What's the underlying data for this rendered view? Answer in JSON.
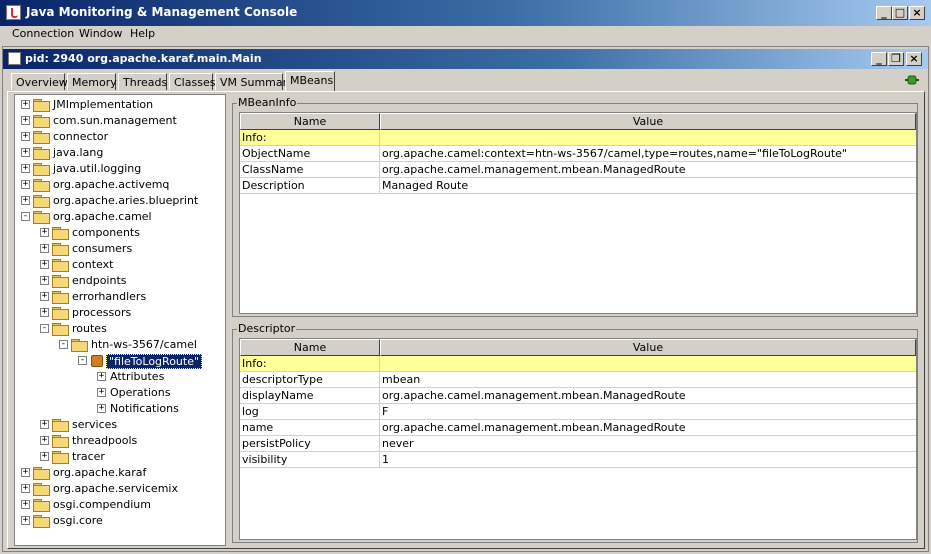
{
  "window": {
    "title": "Java Monitoring & Management Console"
  },
  "menu": [
    "Connection",
    "Window",
    "Help"
  ],
  "inner": {
    "title": "pid: 2940 org.apache.karaf.main.Main"
  },
  "tabs": [
    "Overview",
    "Memory",
    "Threads",
    "Classes",
    "VM Summary",
    "MBeans"
  ],
  "active_tab": "MBeans",
  "tree": [
    {
      "label": "JMImplementation",
      "depth": 0,
      "kind": "folder",
      "exp": "+"
    },
    {
      "label": "com.sun.management",
      "depth": 0,
      "kind": "folder",
      "exp": "+"
    },
    {
      "label": "connector",
      "depth": 0,
      "kind": "folder",
      "exp": "+"
    },
    {
      "label": "java.lang",
      "depth": 0,
      "kind": "folder",
      "exp": "+"
    },
    {
      "label": "java.util.logging",
      "depth": 0,
      "kind": "folder",
      "exp": "+"
    },
    {
      "label": "org.apache.activemq",
      "depth": 0,
      "kind": "folder",
      "exp": "+"
    },
    {
      "label": "org.apache.aries.blueprint",
      "depth": 0,
      "kind": "folder",
      "exp": "+"
    },
    {
      "label": "org.apache.camel",
      "depth": 0,
      "kind": "folder",
      "exp": "-"
    },
    {
      "label": "components",
      "depth": 1,
      "kind": "folder",
      "exp": "+"
    },
    {
      "label": "consumers",
      "depth": 1,
      "kind": "folder",
      "exp": "+"
    },
    {
      "label": "context",
      "depth": 1,
      "kind": "folder",
      "exp": "+"
    },
    {
      "label": "endpoints",
      "depth": 1,
      "kind": "folder",
      "exp": "+"
    },
    {
      "label": "errorhandlers",
      "depth": 1,
      "kind": "folder",
      "exp": "+"
    },
    {
      "label": "processors",
      "depth": 1,
      "kind": "folder",
      "exp": "+"
    },
    {
      "label": "routes",
      "depth": 1,
      "kind": "folder",
      "exp": "-"
    },
    {
      "label": "htn-ws-3567/camel",
      "depth": 2,
      "kind": "folder",
      "exp": "-"
    },
    {
      "label": "\"fileToLogRoute\"",
      "depth": 3,
      "kind": "bean",
      "exp": "-",
      "selected": true
    },
    {
      "label": "Attributes",
      "depth": 4,
      "kind": "leaf",
      "exp": "+"
    },
    {
      "label": "Operations",
      "depth": 4,
      "kind": "leaf",
      "exp": "+"
    },
    {
      "label": "Notifications",
      "depth": 4,
      "kind": "leaf",
      "exp": "+"
    },
    {
      "label": "services",
      "depth": 1,
      "kind": "folder",
      "exp": "+"
    },
    {
      "label": "threadpools",
      "depth": 1,
      "kind": "folder",
      "exp": "+"
    },
    {
      "label": "tracer",
      "depth": 1,
      "kind": "folder",
      "exp": "+"
    },
    {
      "label": "org.apache.karaf",
      "depth": 0,
      "kind": "folder",
      "exp": "+"
    },
    {
      "label": "org.apache.servicemix",
      "depth": 0,
      "kind": "folder",
      "exp": "+"
    },
    {
      "label": "osgi.compendium",
      "depth": 0,
      "kind": "folder",
      "exp": "+"
    },
    {
      "label": "osgi.core",
      "depth": 0,
      "kind": "folder",
      "exp": "+"
    }
  ],
  "mbeaninfo": {
    "title": "MBeanInfo",
    "col_name": "Name",
    "col_value": "Value",
    "rows": [
      {
        "name": "Info:",
        "value": "",
        "info": true
      },
      {
        "name": "ObjectName",
        "value": "org.apache.camel:context=htn-ws-3567/camel,type=routes,name=\"fileToLogRoute\""
      },
      {
        "name": "ClassName",
        "value": "org.apache.camel.management.mbean.ManagedRoute"
      },
      {
        "name": "Description",
        "value": "Managed Route"
      }
    ]
  },
  "descriptor": {
    "title": "Descriptor",
    "col_name": "Name",
    "col_value": "Value",
    "rows": [
      {
        "name": "Info:",
        "value": "",
        "info": true
      },
      {
        "name": "descriptorType",
        "value": "mbean"
      },
      {
        "name": "displayName",
        "value": "org.apache.camel.management.mbean.ManagedRoute"
      },
      {
        "name": "log",
        "value": "F"
      },
      {
        "name": "name",
        "value": "org.apache.camel.management.mbean.ManagedRoute"
      },
      {
        "name": "persistPolicy",
        "value": "never"
      },
      {
        "name": "visibility",
        "value": "1"
      }
    ]
  },
  "icons": {
    "app": "java-cup-icon",
    "connection": "plug-connected-icon"
  },
  "colors": {
    "titlebar": "#0a246a",
    "selection": "#0a246a",
    "info_row": "#ffff99",
    "folder": "#f6d878"
  }
}
